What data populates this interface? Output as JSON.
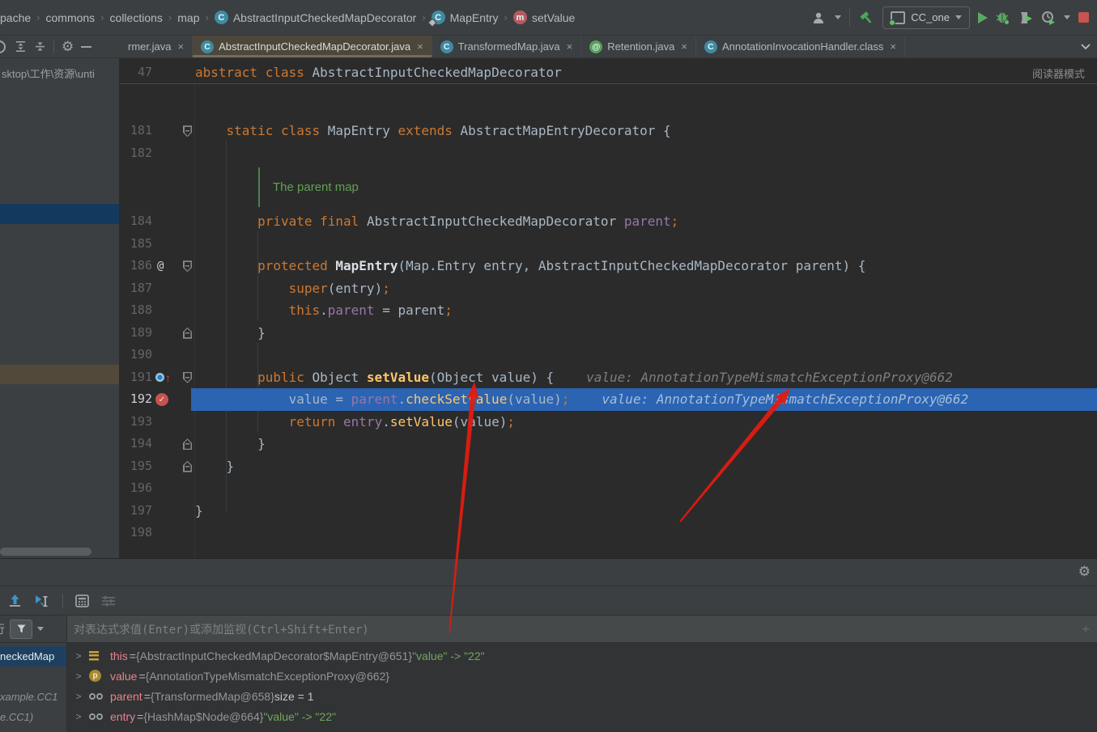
{
  "breadcrumb": {
    "items": [
      {
        "label": "pache",
        "icon": null
      },
      {
        "label": "commons",
        "icon": null
      },
      {
        "label": "collections",
        "icon": null
      },
      {
        "label": "map",
        "icon": null
      },
      {
        "label": "AbstractInputCheckedMapDecorator",
        "icon": "class"
      },
      {
        "label": "MapEntry",
        "icon": "class-inner"
      },
      {
        "label": "setValue",
        "icon": "method"
      }
    ]
  },
  "toolbar": {
    "run_config": "CC_one",
    "icons": [
      "user",
      "hammer-build",
      "run-config",
      "run-play",
      "debug-bug",
      "coverage",
      "profiler",
      "stop"
    ]
  },
  "tabs": [
    {
      "label": "rmer.java",
      "icon": null,
      "active": false
    },
    {
      "label": "AbstractInputCheckedMapDecorator.java",
      "icon": "class",
      "active": true
    },
    {
      "label": "TransformedMap.java",
      "icon": "class",
      "active": false
    },
    {
      "label": "Retention.java",
      "icon": "annotation",
      "active": false
    },
    {
      "label": "AnnotationInvocationHandler.class",
      "icon": "class",
      "active": false
    }
  ],
  "sidebar": {
    "path_text": "sktop\\工作\\资源\\unti"
  },
  "editor": {
    "sticky_line_number": "47",
    "sticky_tokens": [
      [
        "abstract",
        "kw"
      ],
      [
        " ",
        "id"
      ],
      [
        "class",
        "kw"
      ],
      [
        " AbstractInputCheckedMapDecorator",
        "id"
      ]
    ],
    "reader_mode_label": "阅读器模式",
    "doc_comment": "The parent map",
    "lines": [
      {
        "num": "181",
        "fold": "open",
        "tokens": [
          [
            "    ",
            "id"
          ],
          [
            "static",
            "kw"
          ],
          [
            " ",
            "id"
          ],
          [
            "class",
            "kw"
          ],
          [
            " MapEntry ",
            "id"
          ],
          [
            "extends",
            "kw"
          ],
          [
            " AbstractMapEntryDecorator {",
            "id"
          ]
        ]
      },
      {
        "num": "182",
        "tokens": []
      },
      {
        "type": "doc"
      },
      {
        "num": "184",
        "tokens": [
          [
            "        ",
            "id"
          ],
          [
            "private",
            "kw"
          ],
          [
            " ",
            "id"
          ],
          [
            "final",
            "kw"
          ],
          [
            " AbstractInputCheckedMapDecorator ",
            "id"
          ],
          [
            "parent",
            "fld"
          ],
          [
            ";",
            "kw"
          ]
        ]
      },
      {
        "num": "185",
        "tokens": []
      },
      {
        "num": "186",
        "gutter": "at",
        "fold": "open",
        "tokens": [
          [
            "        ",
            "id"
          ],
          [
            "protected",
            "kw"
          ],
          [
            " ",
            "id"
          ],
          [
            "MapEntry",
            "decl"
          ],
          [
            "(Map.Entry entry, AbstractInputCheckedMapDecorator parent) {",
            "id"
          ]
        ]
      },
      {
        "num": "187",
        "tokens": [
          [
            "            ",
            "id"
          ],
          [
            "super",
            "kw"
          ],
          [
            "(entry)",
            "id"
          ],
          [
            ";",
            "kw"
          ]
        ]
      },
      {
        "num": "188",
        "tokens": [
          [
            "            ",
            "id"
          ],
          [
            "this",
            "kw"
          ],
          [
            ".",
            "id"
          ],
          [
            "parent",
            "fld"
          ],
          [
            " = parent",
            "id"
          ],
          [
            ";",
            "kw"
          ]
        ]
      },
      {
        "num": "189",
        "fold": "close",
        "tokens": [
          [
            "        }",
            "id"
          ]
        ]
      },
      {
        "num": "190",
        "tokens": []
      },
      {
        "num": "191",
        "gutter": "override",
        "fold": "open",
        "tokens": [
          [
            "        ",
            "id"
          ],
          [
            "public",
            "kw"
          ],
          [
            " Object ",
            "id"
          ],
          [
            "setValue",
            "mdecl"
          ],
          [
            "(Object value) {",
            "id"
          ]
        ],
        "hint": "value: AnnotationTypeMismatchExceptionProxy@662"
      },
      {
        "num": "192",
        "gutter": "breakpoint",
        "exec": true,
        "tokens": [
          [
            "            value = ",
            "id"
          ],
          [
            "parent",
            "fld"
          ],
          [
            ".",
            "id"
          ],
          [
            "checkSetValue",
            "mth"
          ],
          [
            "(value)",
            "id"
          ],
          [
            ";",
            "kw"
          ]
        ],
        "hint": "value: AnnotationTypeMismatchExceptionProxy@662"
      },
      {
        "num": "193",
        "tokens": [
          [
            "            ",
            "id"
          ],
          [
            "return",
            "kw"
          ],
          [
            " ",
            "id"
          ],
          [
            "entry",
            "fld"
          ],
          [
            ".",
            "id"
          ],
          [
            "setValue",
            "mth"
          ],
          [
            "(value)",
            "id"
          ],
          [
            ";",
            "kw"
          ]
        ]
      },
      {
        "num": "194",
        "fold": "close",
        "tokens": [
          [
            "        }",
            "id"
          ]
        ]
      },
      {
        "num": "195",
        "fold": "close",
        "tokens": [
          [
            "    }",
            "id"
          ]
        ]
      },
      {
        "num": "196",
        "tokens": []
      },
      {
        "num": "197",
        "tokens": [
          [
            "}",
            "id"
          ]
        ]
      },
      {
        "num": "198",
        "tokens": []
      }
    ]
  },
  "debug": {
    "evaluate_placeholder": "对表达式求值(Enter)或添加监视(Ctrl+Shift+Enter)",
    "filter_partial_char": "行",
    "frames": [
      {
        "label": "neckedMap",
        "selected": true,
        "italic": false
      },
      {
        "label": "",
        "selected": false,
        "italic": false
      },
      {
        "label": "xample.CC1",
        "selected": false,
        "italic": true
      },
      {
        "label": "e.CC1)",
        "selected": false,
        "italic": true
      }
    ],
    "variables": [
      {
        "icon": "this",
        "name": "this",
        "parts": [
          [
            " = ",
            "eq"
          ],
          [
            "{AbstractInputCheckedMapDecorator$MapEntry@651} ",
            "ref"
          ],
          [
            "\"value\" -> \"22\"",
            "str"
          ]
        ]
      },
      {
        "icon": "param",
        "name": "value",
        "parts": [
          [
            " = ",
            "eq"
          ],
          [
            "{AnnotationTypeMismatchExceptionProxy@662}",
            "ref"
          ]
        ]
      },
      {
        "icon": "field",
        "name": "parent",
        "parts": [
          [
            " = ",
            "eq"
          ],
          [
            "{TransformedMap@658}  ",
            "ref"
          ],
          [
            "size = 1",
            "plain"
          ]
        ]
      },
      {
        "icon": "field",
        "name": "entry",
        "parts": [
          [
            " = ",
            "eq"
          ],
          [
            "{HashMap$Node@664} ",
            "ref"
          ],
          [
            "\"value\" -> \"22\"",
            "str"
          ]
        ]
      }
    ]
  },
  "colors": {
    "panel_bg": "#3c3f41",
    "editor_bg": "#2b2b2b",
    "exec_line_blue": "#2b64b2",
    "breakpoint_red": "#c4544e",
    "keyword_orange": "#cc7832",
    "field_purple": "#9876aa",
    "method_yellow": "#ffc66d",
    "doc_green": "#61a053",
    "string_green": "#73a75c",
    "annotation_arrow_red": "#e01b10"
  }
}
